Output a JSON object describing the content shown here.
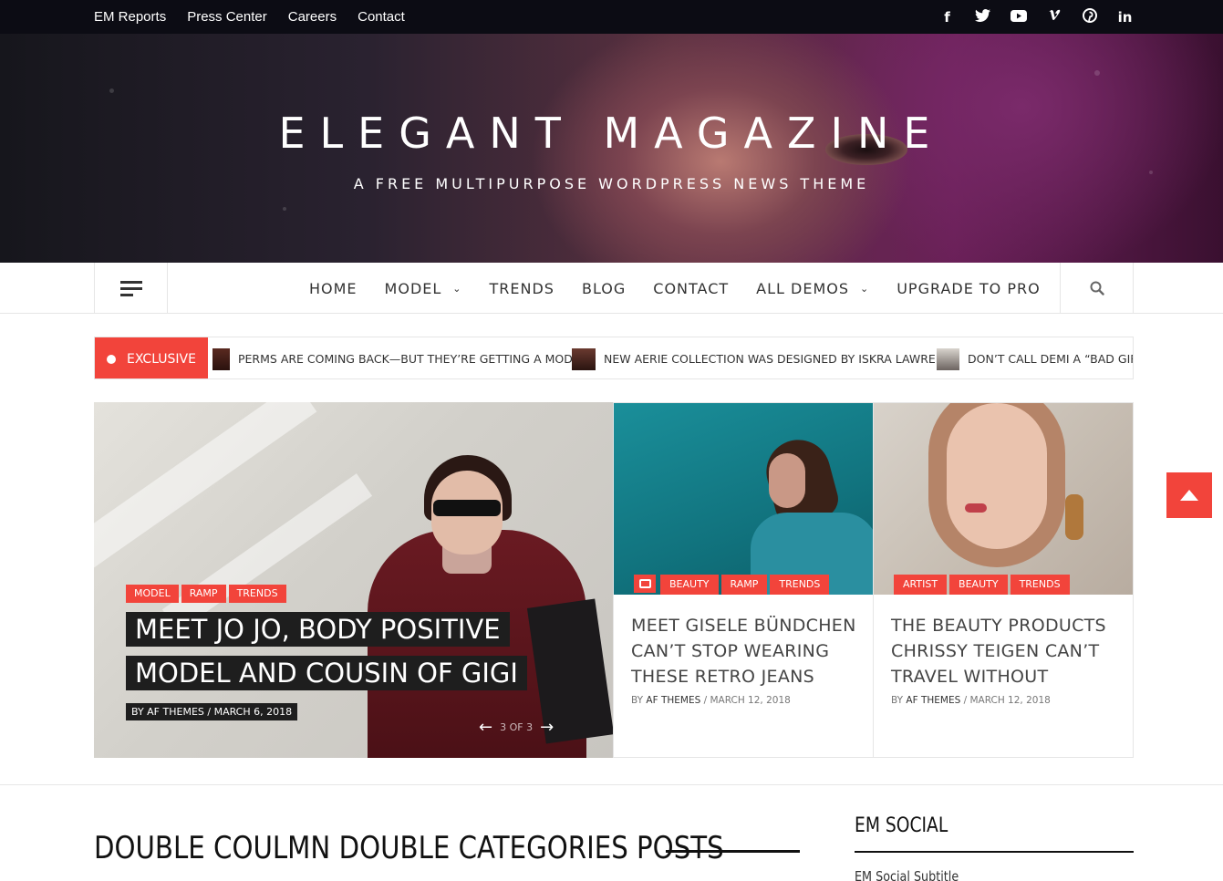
{
  "topbar": {
    "links": [
      "EM Reports",
      "Press Center",
      "Careers",
      "Contact"
    ],
    "social_icons": [
      {
        "name": "facebook-icon",
        "glyph": "f"
      },
      {
        "name": "twitter-icon",
        "glyph": "🐦"
      },
      {
        "name": "youtube-icon",
        "glyph": "▶"
      },
      {
        "name": "vimeo-icon",
        "glyph": "v"
      },
      {
        "name": "pinterest-icon",
        "glyph": "℗"
      },
      {
        "name": "linkedin-icon",
        "glyph": "in"
      }
    ]
  },
  "header": {
    "title": "ELEGANT MAGAZINE",
    "tagline": "A FREE MULTIPURPOSE WORDPRESS NEWS THEME"
  },
  "nav": {
    "items": [
      {
        "label": "HOME",
        "dropdown": false
      },
      {
        "label": "MODEL",
        "dropdown": true
      },
      {
        "label": "TRENDS",
        "dropdown": false
      },
      {
        "label": "BLOG",
        "dropdown": false
      },
      {
        "label": "CONTACT",
        "dropdown": false
      },
      {
        "label": "ALL DEMOS",
        "dropdown": true
      },
      {
        "label": "UPGRADE TO PRO",
        "dropdown": false
      }
    ]
  },
  "ticker": {
    "label": "EXCLUSIVE",
    "items": [
      "PERMS ARE COMING BACK—BUT THEY’RE GETTING A MODERN",
      "NEW AERIE COLLECTION WAS DESIGNED BY ISKRA LAWRENCE",
      "DON’T CALL DEMI A “BAD GIRL” —"
    ]
  },
  "featured": {
    "categories": [
      "MODEL",
      "RAMP",
      "TRENDS"
    ],
    "title": "MEET JO JO, BODY POSITIVE MODEL AND COUSIN OF GIGI",
    "meta": "BY AF THEMES  /  MARCH 6, 2018",
    "pager": "3 OF 3"
  },
  "cards": [
    {
      "categories": [
        "BEAUTY",
        "RAMP",
        "TRENDS"
      ],
      "title": "MEET GISELE BÜNDCHEN CAN’T STOP WEARING THESE RETRO JEANS",
      "by": "BY ",
      "author": "AF THEMES",
      "date": " / MARCH 12, 2018"
    },
    {
      "categories": [
        "ARTIST",
        "BEAUTY",
        "TRENDS"
      ],
      "title": "THE BEAUTY PRODUCTS CHRISSY TEIGEN CAN’T TRAVEL WITHOUT",
      "by": "BY ",
      "author": "AF THEMES",
      "date": " / MARCH 12, 2018"
    }
  ],
  "section": {
    "title": "DOUBLE COULMN DOUBLE CATEGORIES POSTS"
  },
  "sidebar": {
    "title": "EM SOCIAL",
    "subtitle": "EM Social Subtitle"
  },
  "colors": {
    "accent": "#f2443b",
    "topbar": "#0c0c14"
  }
}
